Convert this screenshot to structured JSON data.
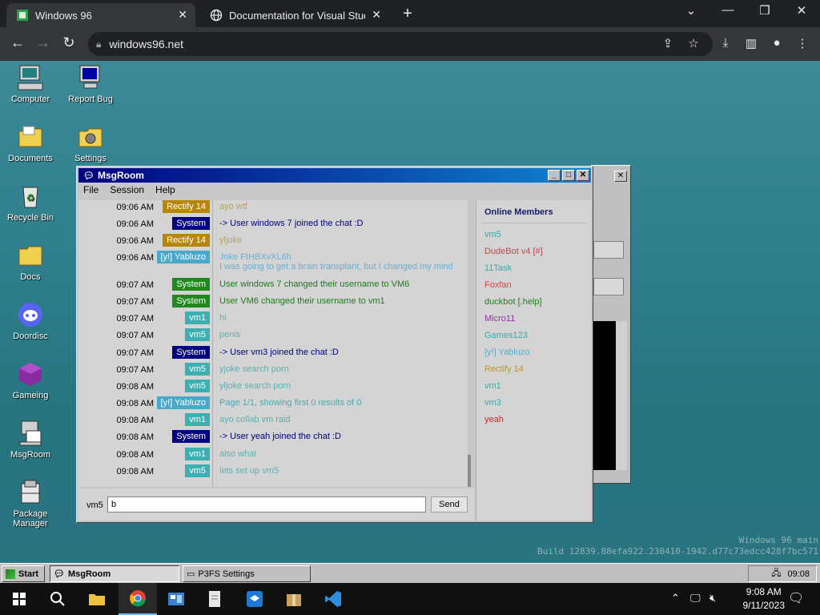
{
  "browser": {
    "tabs": [
      {
        "title": "Windows 96",
        "active": true
      },
      {
        "title": "Documentation for Visual Studio",
        "active": false
      }
    ],
    "url": "windows96.net"
  },
  "desktop_icons": [
    {
      "label": "Computer",
      "icon": "computer-icon"
    },
    {
      "label": "Report Bug",
      "icon": "report-bug-icon"
    },
    {
      "label": "Documents",
      "icon": "folder-icon"
    },
    {
      "label": "Settings",
      "icon": "settings-icon"
    },
    {
      "label": "Recycle Bin",
      "icon": "recycle-bin-icon"
    },
    {
      "label": "Docs",
      "icon": "folder-icon"
    },
    {
      "label": "Doordisc",
      "icon": "discord-icon"
    },
    {
      "label": "Gameing",
      "icon": "cube-icon"
    },
    {
      "label": "MsgRoom",
      "icon": "msgroom-icon"
    },
    {
      "label": "Package Manager",
      "icon": "package-icon"
    }
  ],
  "watermark": {
    "line1": "Windows 96 main",
    "line2": "Build 12839.88efa922.230410-1942.d77c73edcc428f7bc571"
  },
  "msgroom": {
    "title": "MsgRoom",
    "menu": [
      "File",
      "Session",
      "Help"
    ],
    "messages": [
      {
        "time": "09:06 AM",
        "user": "Rectify 14",
        "color": "#b8860b",
        "text": "ayo wtf",
        "text_color": "#b8a060"
      },
      {
        "time": "09:06 AM",
        "user": "System",
        "color": "#000080",
        "text": "-> User windows 7 joined the chat :D",
        "text_color": "#000080"
      },
      {
        "time": "09:06 AM",
        "user": "Rectify 14",
        "color": "#b8860b",
        "text": "yljoke",
        "text_color": "#b8a060"
      },
      {
        "time": "09:06 AM",
        "user": "[y!] Yabluzo",
        "color": "#4aa8c8",
        "text": "Joke FtHBXvXL6h",
        "text2": "I was going to get a brain transplant, but I changed my mind",
        "text_color": "#6aaed0"
      },
      {
        "time": "09:07 AM",
        "user": "System",
        "color": "#1e8a1e",
        "text": "User windows 7 changed their username to VM6",
        "text_color": "#1e7a1e"
      },
      {
        "time": "09:07 AM",
        "user": "System",
        "color": "#1e8a1e",
        "text": "User VM6 changed their username to vm1",
        "text_color": "#1e7a1e"
      },
      {
        "time": "09:07 AM",
        "user": "vm1",
        "color": "#3cb0b0",
        "text": "hi",
        "text_color": "#5ab0b0"
      },
      {
        "time": "09:07 AM",
        "user": "vm5",
        "color": "#3cb0b0",
        "text": "penis",
        "text_color": "#5ab0b0"
      },
      {
        "time": "09:07 AM",
        "user": "System",
        "color": "#000080",
        "text": "-> User vm3 joined the chat :D",
        "text_color": "#000080"
      },
      {
        "time": "09:07 AM",
        "user": "vm5",
        "color": "#3cb0b0",
        "text": "yjoke search porn",
        "text_color": "#5ab0b0"
      },
      {
        "time": "09:08 AM",
        "user": "vm5",
        "color": "#3cb0b0",
        "text": "yljoke search porn",
        "text_color": "#5ab0b0"
      },
      {
        "time": "09:08 AM",
        "user": "[y!] Yabluzo",
        "color": "#4aa8c8",
        "text": "Page 1/1, showing first 0 results of 0",
        "text_color": "#4aa8b0"
      },
      {
        "time": "09:08 AM",
        "user": "vm1",
        "color": "#3cb0b0",
        "text": "ayo collab vm raid",
        "text_color": "#5ab0b0"
      },
      {
        "time": "09:08 AM",
        "user": "System",
        "color": "#000080",
        "text": "-> User yeah joined the chat :D",
        "text_color": "#000080"
      },
      {
        "time": "09:08 AM",
        "user": "vm1",
        "color": "#3cb0b0",
        "text": "also what",
        "text_color": "#5ab0b0"
      },
      {
        "time": "09:08 AM",
        "user": "vm5",
        "color": "#3cb0b0",
        "text": "lets set up vm5",
        "text_color": "#5ab0b0"
      }
    ],
    "members_title": "Online Members",
    "members": [
      {
        "name": "vm5",
        "color": "#3caaaa"
      },
      {
        "name": "DudeBot v4 [#]",
        "color": "#b05050"
      },
      {
        "name": "11Task",
        "color": "#3caaaa"
      },
      {
        "name": "Foxfan",
        "color": "#e04040"
      },
      {
        "name": "duckbot [.help]",
        "color": "#208020"
      },
      {
        "name": "Micro11",
        "color": "#9030a0"
      },
      {
        "name": "Games123",
        "color": "#3caaaa"
      },
      {
        "name": "[y!] Yabluzo",
        "color": "#60aac8"
      },
      {
        "name": "Rectify 14",
        "color": "#b8962a"
      },
      {
        "name": "vm1",
        "color": "#3caaaa"
      },
      {
        "name": "vm3",
        "color": "#3caaaa"
      },
      {
        "name": "yeah",
        "color": "#e02020"
      }
    ],
    "input_user": "vm5",
    "input_value": "b",
    "send_label": "Send"
  },
  "w96taskbar": {
    "start_label": "Start",
    "tasks": [
      "MsgRoom",
      "P3FS Settings"
    ],
    "time": "09:08"
  },
  "win10": {
    "time": "9:08 AM",
    "date": "9/11/2023"
  }
}
